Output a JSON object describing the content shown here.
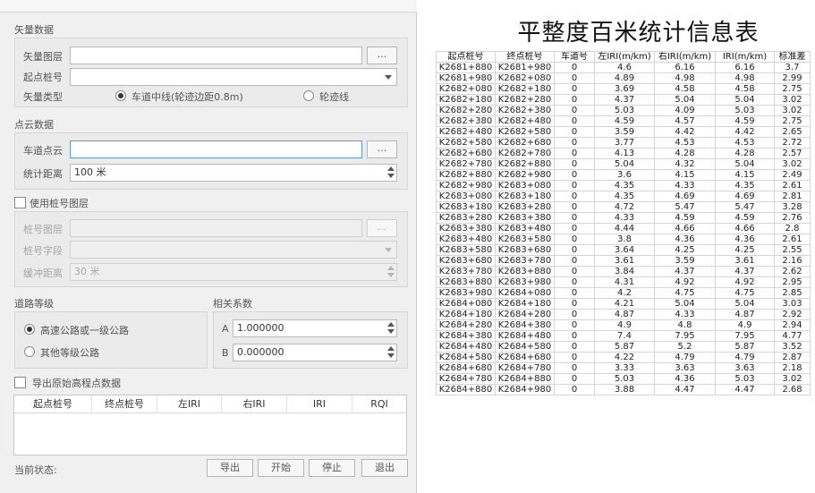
{
  "dialog": {
    "vector_section": {
      "title": "矢量数据",
      "layer_label": "矢量图层",
      "layer_value": "",
      "start_pile_label": "起点桩号",
      "start_pile_value": "",
      "type_label": "矢量类型",
      "option_center": "车道中线(轮迹边距0.8m)",
      "option_wheel": "轮迹线",
      "browse_label": "...",
      "selected_type": "center"
    },
    "cloud_section": {
      "title": "点云数据",
      "lane_cloud_label": "车道点云",
      "lane_cloud_value": "",
      "browse_label": "...",
      "distance_label": "统计距离",
      "distance_value": "100 米"
    },
    "pile_layer": {
      "checkbox_label": "使用桩号图层",
      "checked": false,
      "layer_label": "桩号图层",
      "layer_value": "",
      "browse_label": "...",
      "field_label": "桩号字段",
      "field_value": "",
      "buffer_label": "缓冲距离",
      "buffer_value": "30 米"
    },
    "road_grade": {
      "title": "道路等级",
      "option_highway": "高速公路或一级公路",
      "option_other": "其他等级公路",
      "selected": "highway"
    },
    "coefficients": {
      "title": "相关系数",
      "a_label": "A",
      "a_value": "1.000000",
      "b_label": "B",
      "b_value": "0.000000"
    },
    "export_raw": {
      "checkbox_label": "导出原始高程点数据",
      "checked": false
    },
    "result_list": {
      "columns": [
        "起点桩号",
        "终点桩号",
        "左IRI",
        "右IRI",
        "IRI",
        "RQI"
      ]
    },
    "status_label": "当前状态:",
    "buttons": {
      "export": "导出",
      "start": "开始",
      "stop": "停止",
      "exit": "退出"
    }
  },
  "report": {
    "title": "平整度百米统计信息表",
    "columns": [
      "起点桩号",
      "终点桩号",
      "车道号",
      "左IRI(m/km)",
      "右IRI(m/km)",
      "IRI(m/km)",
      "标准差"
    ],
    "rows": [
      [
        "K2681+880",
        "K2681+980",
        "0",
        "4.6",
        "6.16",
        "6.16",
        "3.7"
      ],
      [
        "K2681+980",
        "K2682+080",
        "0",
        "4.89",
        "4.98",
        "4.98",
        "2.99"
      ],
      [
        "K2682+080",
        "K2682+180",
        "0",
        "3.69",
        "4.58",
        "4.58",
        "2.75"
      ],
      [
        "K2682+180",
        "K2682+280",
        "0",
        "4.37",
        "5.04",
        "5.04",
        "3.02"
      ],
      [
        "K2682+280",
        "K2682+380",
        "0",
        "5.03",
        "4.09",
        "5.03",
        "3.02"
      ],
      [
        "K2682+380",
        "K2682+480",
        "0",
        "4.59",
        "4.57",
        "4.59",
        "2.75"
      ],
      [
        "K2682+480",
        "K2682+580",
        "0",
        "3.59",
        "4.42",
        "4.42",
        "2.65"
      ],
      [
        "K2682+580",
        "K2682+680",
        "0",
        "3.77",
        "4.53",
        "4.53",
        "2.72"
      ],
      [
        "K2682+680",
        "K2682+780",
        "0",
        "4.13",
        "4.28",
        "4.28",
        "2.57"
      ],
      [
        "K2682+780",
        "K2682+880",
        "0",
        "5.04",
        "4.32",
        "5.04",
        "3.02"
      ],
      [
        "K2682+880",
        "K2682+980",
        "0",
        "3.6",
        "4.15",
        "4.15",
        "2.49"
      ],
      [
        "K2682+980",
        "K2683+080",
        "0",
        "4.35",
        "4.33",
        "4.35",
        "2.61"
      ],
      [
        "K2683+080",
        "K2683+180",
        "0",
        "4.35",
        "4.69",
        "4.69",
        "2.81"
      ],
      [
        "K2683+180",
        "K2683+280",
        "0",
        "4.72",
        "5.47",
        "5.47",
        "3.28"
      ],
      [
        "K2683+280",
        "K2683+380",
        "0",
        "4.33",
        "4.59",
        "4.59",
        "2.76"
      ],
      [
        "K2683+380",
        "K2683+480",
        "0",
        "4.44",
        "4.66",
        "4.66",
        "2.8"
      ],
      [
        "K2683+480",
        "K2683+580",
        "0",
        "3.8",
        "4.36",
        "4.36",
        "2.61"
      ],
      [
        "K2683+580",
        "K2683+680",
        "0",
        "3.64",
        "4.25",
        "4.25",
        "2.55"
      ],
      [
        "K2683+680",
        "K2683+780",
        "0",
        "3.61",
        "3.59",
        "3.61",
        "2.16"
      ],
      [
        "K2683+780",
        "K2683+880",
        "0",
        "3.84",
        "4.37",
        "4.37",
        "2.62"
      ],
      [
        "K2683+880",
        "K2683+980",
        "0",
        "4.31",
        "4.92",
        "4.92",
        "2.95"
      ],
      [
        "K2683+980",
        "K2684+080",
        "0",
        "4.2",
        "4.75",
        "4.75",
        "2.85"
      ],
      [
        "K2684+080",
        "K2684+180",
        "0",
        "4.21",
        "5.04",
        "5.04",
        "3.03"
      ],
      [
        "K2684+180",
        "K2684+280",
        "0",
        "4.87",
        "4.33",
        "4.87",
        "2.92"
      ],
      [
        "K2684+280",
        "K2684+380",
        "0",
        "4.9",
        "4.8",
        "4.9",
        "2.94"
      ],
      [
        "K2684+380",
        "K2684+480",
        "0",
        "7.4",
        "7.95",
        "7.95",
        "4.77"
      ],
      [
        "K2684+480",
        "K2684+580",
        "0",
        "5.87",
        "5.2",
        "5.87",
        "3.52"
      ],
      [
        "K2684+580",
        "K2684+680",
        "0",
        "4.22",
        "4.79",
        "4.79",
        "2.87"
      ],
      [
        "K2684+680",
        "K2684+780",
        "0",
        "3.33",
        "3.63",
        "3.63",
        "2.18"
      ],
      [
        "K2684+780",
        "K2684+880",
        "0",
        "5.03",
        "4.36",
        "5.03",
        "3.02"
      ],
      [
        "K2684+880",
        "K2684+980",
        "0",
        "3.88",
        "4.47",
        "4.47",
        "2.68"
      ]
    ]
  }
}
